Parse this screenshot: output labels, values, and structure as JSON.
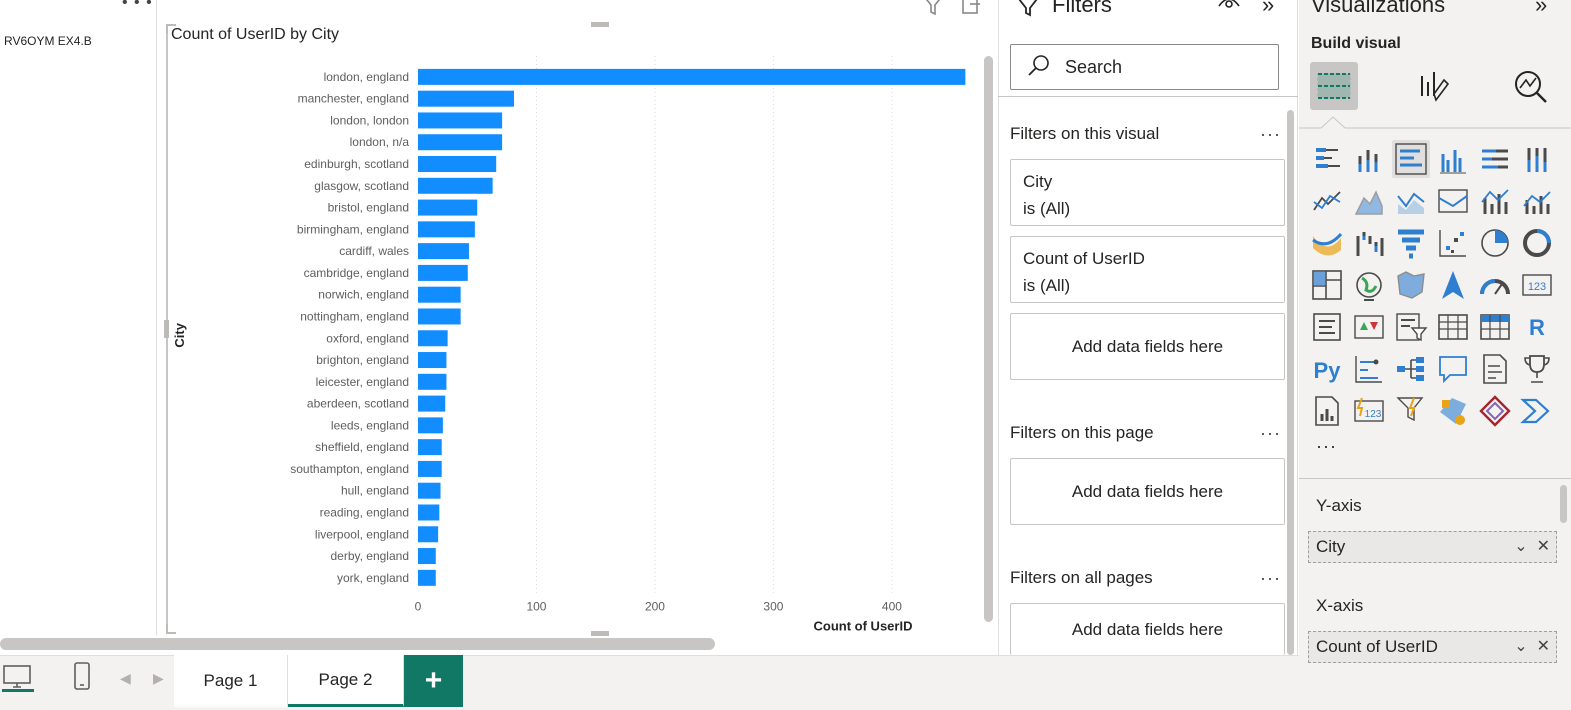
{
  "canvas": {
    "left_text": "RV6OYM EX4.B"
  },
  "chart": {
    "title": "Count of UserID by City"
  },
  "chart_data": {
    "type": "bar",
    "orientation": "horizontal",
    "title": "Count of UserID by City",
    "xlabel": "Count of UserID",
    "ylabel": "City",
    "xlim": [
      0,
      460
    ],
    "xticks": [
      0,
      100,
      200,
      300,
      400
    ],
    "bar_color": "#118DFF",
    "categories": [
      "london, england",
      "manchester, england",
      "london, london",
      "london, n/a",
      "edinburgh, scotland",
      "glasgow, scotland",
      "bristol, england",
      "birmingham, england",
      "cardiff, wales",
      "cambridge, england",
      "norwich, england",
      "nottingham, england",
      "oxford, england",
      "brighton, england",
      "leicester, england",
      "aberdeen, scotland",
      "leeds, england",
      "sheffield, england",
      "southampton, england",
      "hull, england",
      "reading, england",
      "liverpool, england",
      "derby, england",
      "york, england"
    ],
    "values": [
      462,
      81,
      71,
      71,
      66,
      63,
      50,
      48,
      43,
      42,
      36,
      36,
      25,
      24,
      24,
      23,
      21,
      20,
      20,
      19,
      18,
      17,
      15,
      15
    ]
  },
  "filters": {
    "title": "Filters",
    "search_label": "Search",
    "on_visual": "Filters on this visual",
    "card1": {
      "field": "City",
      "state": "is (All)"
    },
    "card2": {
      "field": "Count of UserID",
      "state": "is (All)"
    },
    "add_fields": "Add data fields here",
    "on_page": "Filters on this page",
    "on_all": "Filters on all pages",
    "dots": "···"
  },
  "visualizations": {
    "title": "Visualizations",
    "build_visual": "Build visual",
    "more": "···",
    "y_axis_label": "Y-axis",
    "y_axis_field": "City",
    "x_axis_label": "X-axis",
    "x_axis_field": "Count of UserID"
  },
  "pages": {
    "page1": "Page 1",
    "page2": "Page 2",
    "add": "+"
  },
  "colors": {
    "accent": "#117865",
    "bar": "#118DFF"
  }
}
